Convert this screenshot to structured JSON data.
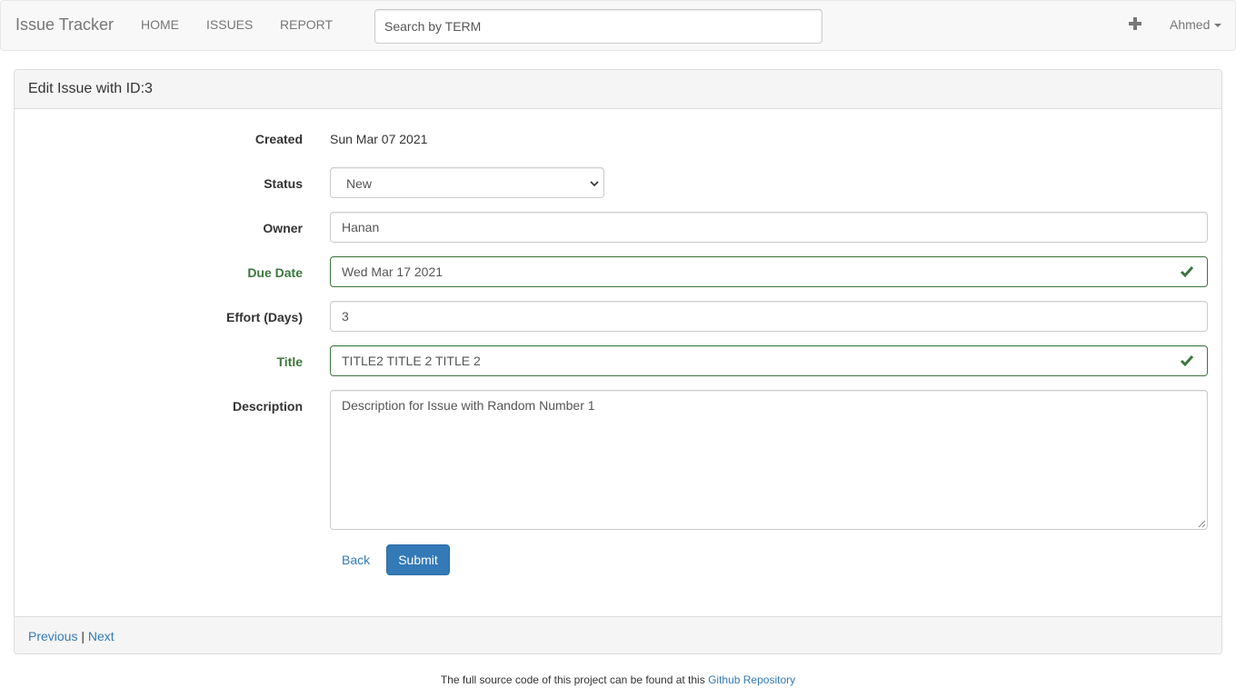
{
  "navbar": {
    "brand": "Issue Tracker",
    "links": [
      {
        "label": "HOME"
      },
      {
        "label": "ISSUES"
      },
      {
        "label": "REPORT"
      }
    ],
    "search_placeholder": "Search by TERM",
    "add_icon": "plus-icon",
    "user": "Ahmed"
  },
  "panel": {
    "heading": "Edit Issue with ID:3",
    "form": {
      "created_label": "Created",
      "created_value": "Sun Mar 07 2021",
      "status_label": "Status",
      "status_value": "New",
      "owner_label": "Owner",
      "owner_value": "Hanan",
      "due_label": "Due Date",
      "due_value": "Wed Mar 17 2021",
      "effort_label": "Effort (Days)",
      "effort_value": "3",
      "title_label": "Title",
      "title_value": "TITLE2 TITLE 2 TITLE 2",
      "description_label": "Description",
      "description_value": "Description for Issue with Random Number 1",
      "back_label": "Back",
      "submit_label": "Submit"
    },
    "footer": {
      "previous_label": "Previous",
      "separator": "|",
      "next_label": "Next"
    }
  },
  "page_footer": {
    "text": "The full source code of this project can be found at this",
    "link_label": "Github Repository"
  },
  "colors": {
    "link": "#337ab7",
    "success": "#3c763d",
    "primary_button": "#337ab7"
  }
}
